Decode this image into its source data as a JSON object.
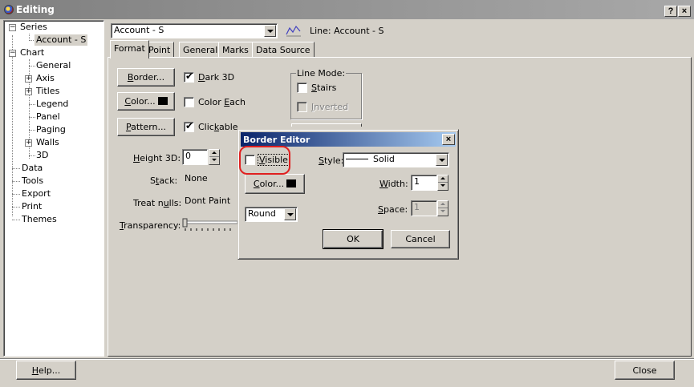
{
  "window": {
    "title": "Editing",
    "help_symbol": "?",
    "close_symbol": "×"
  },
  "tree": {
    "items": [
      {
        "label": "Series",
        "expander": "−"
      },
      {
        "label": "Account - S"
      },
      {
        "label": "Chart",
        "expander": "−"
      },
      {
        "label": "General"
      },
      {
        "label": "Axis",
        "expander": "+"
      },
      {
        "label": "Titles",
        "expander": "+"
      },
      {
        "label": "Legend"
      },
      {
        "label": "Panel"
      },
      {
        "label": "Paging"
      },
      {
        "label": "Walls",
        "expander": "+"
      },
      {
        "label": "3D"
      },
      {
        "label": "Data"
      },
      {
        "label": "Tools"
      },
      {
        "label": "Export"
      },
      {
        "label": "Print"
      },
      {
        "label": "Themes"
      }
    ]
  },
  "series_selector": {
    "selected": "Account - S",
    "line_label": "Line: Account - S"
  },
  "tabs": [
    "Format",
    "Point",
    "General",
    "Marks",
    "Data Source"
  ],
  "format": {
    "border_button": {
      "pre": "",
      "key": "B",
      "post": "order..."
    },
    "color_button": {
      "pre": "",
      "key": "C",
      "post": "olor..."
    },
    "pattern_button": {
      "pre": "",
      "key": "P",
      "post": "attern..."
    },
    "dark3d": {
      "pre": "",
      "key": "D",
      "post": "ark 3D",
      "checked": true
    },
    "color_each": {
      "pre": "Color ",
      "key": "E",
      "post": "ach",
      "checked": false
    },
    "clickable": {
      "pre": "Clic",
      "key": "k",
      "post": "able",
      "checked": true
    },
    "height3d": {
      "pre": "",
      "key": "H",
      "post": "eight 3D:",
      "value": "0"
    },
    "stack": {
      "pre": "S",
      "key": "t",
      "post": "ack:",
      "value": "None"
    },
    "treat_nulls": {
      "pre": "Treat n",
      "key": "u",
      "post": "lls:",
      "value": "Dont Paint"
    },
    "transparency": {
      "pre": "",
      "key": "T",
      "post": "ransparency:"
    },
    "line_mode": {
      "title": "Line Mode:",
      "stairs": {
        "pre": "",
        "key": "S",
        "post": "tairs",
        "checked": false
      },
      "inverted": {
        "pre": "",
        "key": "I",
        "post": "nverted",
        "checked": false
      }
    }
  },
  "border_editor": {
    "title": "Border Editor",
    "close_symbol": "×",
    "visible": {
      "pre": "",
      "key": "V",
      "post": "isible",
      "checked": false
    },
    "style": {
      "pre": "",
      "key": "S",
      "post": "tyle:",
      "value": "Solid"
    },
    "color": {
      "pre": "",
      "key": "C",
      "post": "olor..."
    },
    "width": {
      "pre": "",
      "key": "W",
      "post": "idth:",
      "value": "1"
    },
    "join": {
      "value": "Round"
    },
    "space": {
      "pre": "",
      "key": "S",
      "post": "pace:",
      "value": "1"
    },
    "ok": "OK",
    "cancel": "Cancel"
  },
  "footer": {
    "help": {
      "pre": "",
      "key": "H",
      "post": "elp..."
    },
    "close": "Close"
  },
  "colors": {
    "title_active_start": "#0a246a",
    "title_active_end": "#a6caf0",
    "highlight_ring": "#e02020",
    "face": "#d4d0c8"
  }
}
